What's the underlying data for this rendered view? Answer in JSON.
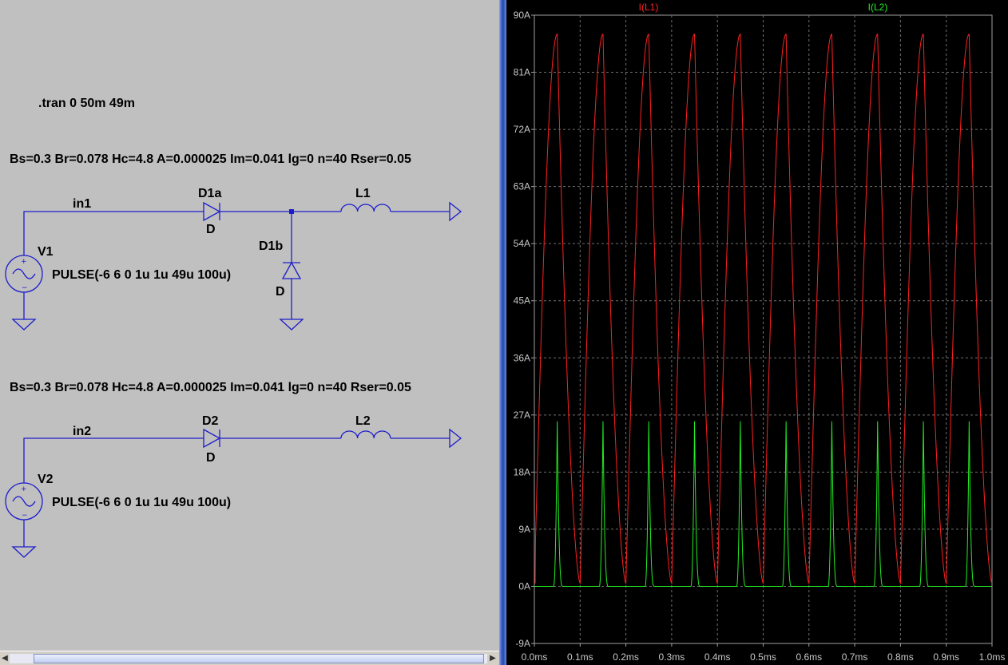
{
  "schematic": {
    "directive": ".tran 0 50m 49m",
    "model_line_1": "Bs=0.3 Br=0.078 Hc=4.8 A=0.000025 Im=0.041 lg=0 n=40 Rser=0.05",
    "model_line_2": "Bs=0.3 Br=0.078 Hc=4.8 A=0.000025 Im=0.041 lg=0 n=40 Rser=0.05",
    "circuit1": {
      "net": "in1",
      "source_name": "V1",
      "source_value": "PULSE(-6 6 0 1u 1u 49u 100u)",
      "diode_series_name": "D1a",
      "diode_series_model": "D",
      "diode_shunt_name": "D1b",
      "diode_shunt_model": "D",
      "inductor": "L1"
    },
    "circuit2": {
      "net": "in2",
      "source_name": "V2",
      "source_value": "PULSE(-6 6 0 1u 1u 49u 100u)",
      "diode_name": "D2",
      "diode_model": "D",
      "inductor": "L2"
    },
    "wire_color": "#1c1ccc"
  },
  "chart_data": {
    "type": "line",
    "x_ticks": [
      "0.0ms",
      "0.1ms",
      "0.2ms",
      "0.3ms",
      "0.4ms",
      "0.5ms",
      "0.6ms",
      "0.7ms",
      "0.8ms",
      "0.9ms",
      "1.0ms"
    ],
    "y_ticks": [
      "90A",
      "81A",
      "72A",
      "63A",
      "54A",
      "45A",
      "36A",
      "27A",
      "18A",
      "9A",
      "0A",
      "-9A"
    ],
    "xlim": [
      0,
      1.0
    ],
    "ylim": [
      -9,
      90
    ],
    "grid": true,
    "series": [
      {
        "name": "I(L1)",
        "color": "#ff2020",
        "period_ms": 0.1,
        "min_value": 0.5,
        "peak_value": 87,
        "peak_time_in_period_ms": 0.05
      },
      {
        "name": "I(L2)",
        "color": "#22ee22",
        "period_ms": 0.1,
        "base_value": 0,
        "peak_value": 26,
        "peak_time_in_period_ms": 0.05
      }
    ]
  }
}
